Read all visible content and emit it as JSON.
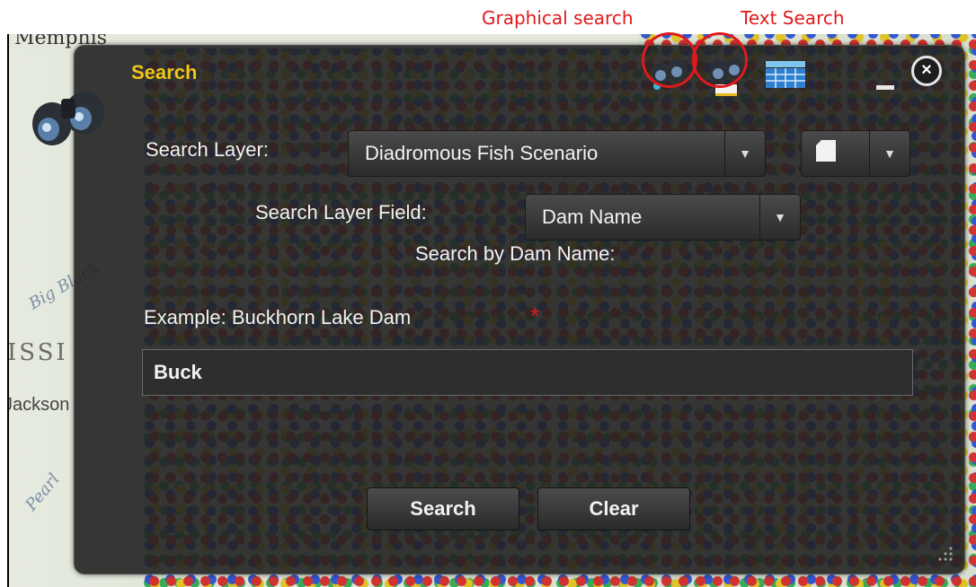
{
  "annotations": {
    "graphical_search": "Graphical search",
    "text_search": "Text Search"
  },
  "map": {
    "labels": [
      "Memphis",
      "Big Black",
      "ISSI",
      "Jackson",
      "Pearl"
    ]
  },
  "panel": {
    "title": "Search",
    "toolbar": {
      "graphical_search_icon": "binoculars-graphic-icon",
      "text_search_icon": "binoculars-text-icon",
      "table_icon": "table-icon"
    },
    "minimize_icon": "minimize-icon",
    "close_glyph": "×",
    "search_layer_label": "Search Layer:",
    "search_layer_value": "Diadromous Fish Scenario",
    "layer_options_icon": "page-icon",
    "search_layer_field_label": "Search Layer Field:",
    "search_layer_field_value": "Dam Name",
    "search_by_label": "Search by Dam Name:",
    "example_label": "Example: Buckhorn Lake Dam",
    "required_star": "*",
    "search_input_value": "Buck",
    "search_button": "Search",
    "clear_button": "Clear"
  },
  "colors": {
    "title": "#f0c419",
    "annotation": "#e0191c",
    "panel_bg": "#222222"
  }
}
